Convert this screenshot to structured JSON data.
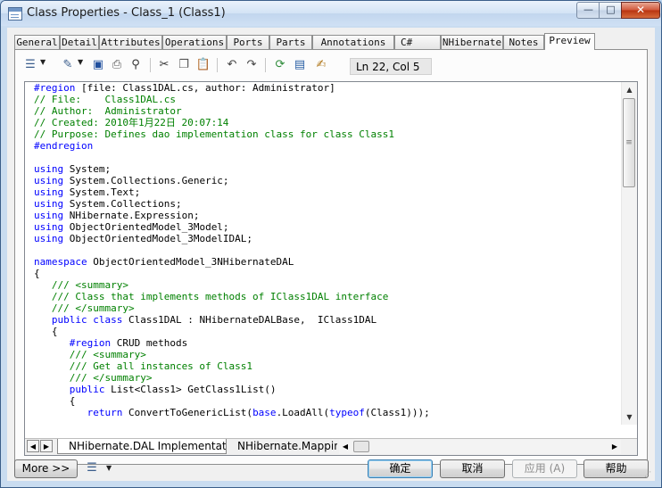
{
  "window": {
    "title": "Class Properties - Class_1 (Class1)",
    "controls": {
      "minimize": "—",
      "maximize": "□",
      "close": "✕"
    }
  },
  "tabs": [
    {
      "label": "General"
    },
    {
      "label": "Detail"
    },
    {
      "label": "Attributes"
    },
    {
      "label": "Operations"
    },
    {
      "label": "Ports"
    },
    {
      "label": "Parts"
    },
    {
      "label": "Annotations"
    },
    {
      "label": "C#"
    },
    {
      "label": "NHibernate"
    },
    {
      "label": "Notes"
    },
    {
      "label": "Preview"
    }
  ],
  "active_tab": "Preview",
  "toolbar": {
    "icons": [
      "editor-menu-icon",
      "properties-icon",
      "save-icon",
      "print-icon",
      "find-icon",
      "cut-icon",
      "copy-icon",
      "paste-icon",
      "undo-icon",
      "redo-icon",
      "refresh-icon",
      "show-generation-options-icon",
      "edit-with-editor-icon"
    ],
    "cursor_position": "Ln 22, Col 5"
  },
  "code_lines": [
    "#region [file: Class1DAL.cs, author: Administrator]",
    "// File:    Class1DAL.cs",
    "// Author:  Administrator",
    "// Created: 2010年1月22日 20:07:14",
    "// Purpose: Defines dao implementation class for class Class1",
    "#endregion",
    "",
    "using System;",
    "using System.Collections.Generic;",
    "using System.Text;",
    "using System.Collections;",
    "using NHibernate.Expression;",
    "using ObjectOrientedModel_3Model;",
    "using ObjectOrientedModel_3ModelIDAL;",
    "",
    "namespace ObjectOrientedModel_3NHibernateDAL",
    "{",
    "   /// <summary>",
    "   /// Class that implements methods of IClass1DAL interface",
    "   /// </summary>",
    "   public class Class1DAL : NHibernateDALBase,  IClass1DAL",
    "   {",
    "      #region CRUD methods",
    "      /// <summary>",
    "      /// Get all instances of Class1",
    "      /// </summary>",
    "      public List<Class1> GetClass1List()",
    "      {",
    "         return ConvertToGenericList(base.LoadAll(typeof(Class1)));",
    "      }"
  ],
  "sheet_tabs": [
    {
      "label": "NHibernate.DAL Implementation"
    },
    {
      "label": "NHibernate.Mapping"
    }
  ],
  "buttons": {
    "more": "More >>",
    "ok": "确定",
    "cancel": "取消",
    "apply": "应用 (A)",
    "help": "帮助"
  }
}
